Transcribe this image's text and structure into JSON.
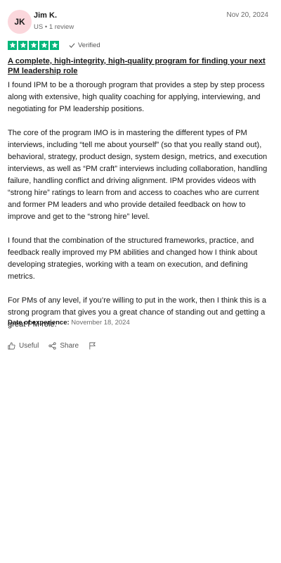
{
  "reviewer": {
    "initials": "JK",
    "name": "Jim K.",
    "country": "US",
    "review_count": "1 review"
  },
  "review": {
    "date": "Nov 20, 2024",
    "rating": 5,
    "verified_label": "Verified",
    "title": "A complete, high-integrity, high-quality program for finding your next PM leadership role",
    "paragraphs": [
      "I found IPM to be a thorough program that provides a step by step process along with extensive, high quality coaching for applying, interviewing, and negotiating for PM leadership positions.",
      "The core of the program IMO is in mastering the different types of PM interviews, including “tell me about yourself” (so that you really stand out), behavioral, strategy, product design, system design, metrics, and execution interviews, as well as “PM craft” interviews including collaboration, handling failure, handling conflict and driving alignment. IPM provides videos with “strong hire” ratings to learn from and access to coaches who are current and former PM leaders and who provide detailed feedback on how to improve and get to the “strong hire” level.",
      "I found that the combination of the structured frameworks, practice, and feedback really improved my PM abilities and changed how I think about developing strategies, working with a team on execution, and defining metrics.",
      "For PMs of any level, if you’re willing to put in the work, then I think this is a strong program that gives you a great chance of standing out and getting a great PM role."
    ],
    "experience_label": "Date of experience:",
    "experience_date": "November 18, 2024"
  },
  "actions": {
    "useful_label": "Useful",
    "share_label": "Share"
  },
  "colors": {
    "star_green": "#00b67a",
    "avatar_pink": "#fbd7dc"
  },
  "icons": [
    "star-icon",
    "check-icon",
    "thumbs-up-icon",
    "share-icon",
    "flag-icon"
  ]
}
